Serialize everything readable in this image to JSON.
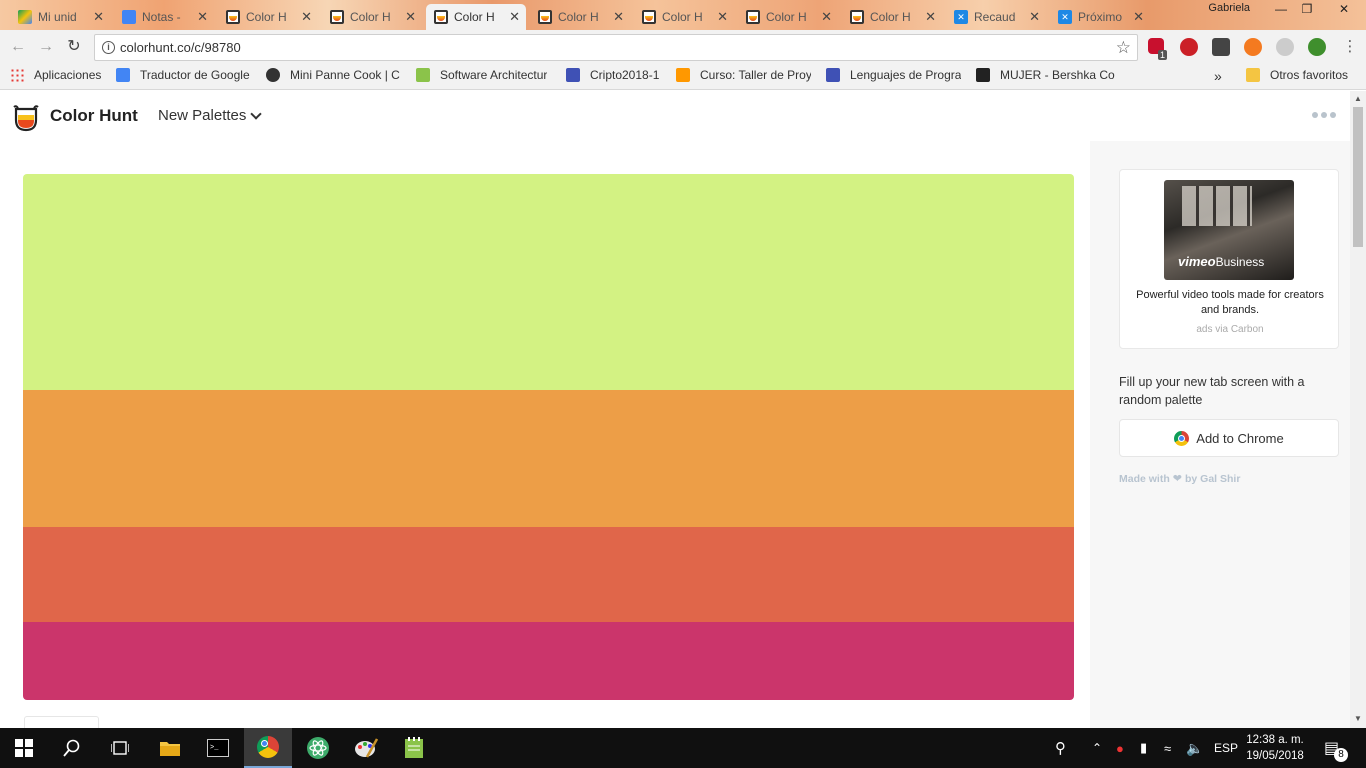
{
  "browser": {
    "tabs": [
      {
        "title": "Mi unid",
        "favicon": "google-drive-icon",
        "active": false
      },
      {
        "title": "Notas -",
        "favicon": "google-docs-icon",
        "active": false
      },
      {
        "title": "Color H",
        "favicon": "color-hunt-icon",
        "active": false
      },
      {
        "title": "Color H",
        "favicon": "color-hunt-icon",
        "active": false
      },
      {
        "title": "Color H",
        "favicon": "color-hunt-icon",
        "active": true
      },
      {
        "title": "Color H",
        "favicon": "color-hunt-icon",
        "active": false
      },
      {
        "title": "Color H",
        "favicon": "color-hunt-icon",
        "active": false
      },
      {
        "title": "Color H",
        "favicon": "color-hunt-icon",
        "active": false
      },
      {
        "title": "Color H",
        "favicon": "color-hunt-icon",
        "active": false
      },
      {
        "title": "Recaud",
        "favicon": "x-app-icon",
        "active": false
      },
      {
        "title": "Próximo",
        "favicon": "x-app-icon",
        "active": false
      }
    ],
    "user": "Gabriela",
    "url": "colorhunt.co/c/98780",
    "bookmarks": [
      {
        "label": "Aplicaciones",
        "icon": "apps-grid-icon"
      },
      {
        "label": "Traductor de Google",
        "icon": "google-translate-icon"
      },
      {
        "label": "Mini Panne Cook | C",
        "icon": "cook-icon"
      },
      {
        "label": "Software Architectur",
        "icon": "software-icon"
      },
      {
        "label": "Cripto2018-1",
        "icon": "calendar-icon"
      },
      {
        "label": "Curso: Taller de Proy",
        "icon": "course-icon"
      },
      {
        "label": "Lenguajes de Progra",
        "icon": "layout-icon"
      },
      {
        "label": "MUJER - Bershka Co",
        "icon": "bershka-icon"
      },
      {
        "label": "Otros favoritos",
        "icon": "folder-icon"
      }
    ],
    "extensions": [
      "adblock-icon",
      "pinterest-icon",
      "lightbulb-icon",
      "orange-ext-icon",
      "skype-icon",
      "profile-icon"
    ],
    "extension_badge": "1",
    "more_bookmarks": "»"
  },
  "site": {
    "brand": "Color Hunt",
    "nav_label": "New Palettes"
  },
  "palette": {
    "colors": [
      "#d3f283",
      "#ed9e47",
      "#e0664a",
      "#cb356b"
    ],
    "bands": [
      0.41,
      0.26,
      0.18,
      0.15
    ]
  },
  "sidebar": {
    "ad": {
      "brand": "vimeo",
      "brand_suffix": "Business",
      "text": "Powerful video tools made for creators and brands.",
      "via": "ads via Carbon"
    },
    "promo_text": "Fill up your new tab screen with a random palette",
    "chrome_button": "Add to Chrome",
    "credit_prefix": "Made with",
    "credit_suffix": "by Gal Shir"
  },
  "taskbar": {
    "language": "ESP",
    "time": "12:38 a. m.",
    "date": "19/05/2018",
    "notifications": "8"
  }
}
